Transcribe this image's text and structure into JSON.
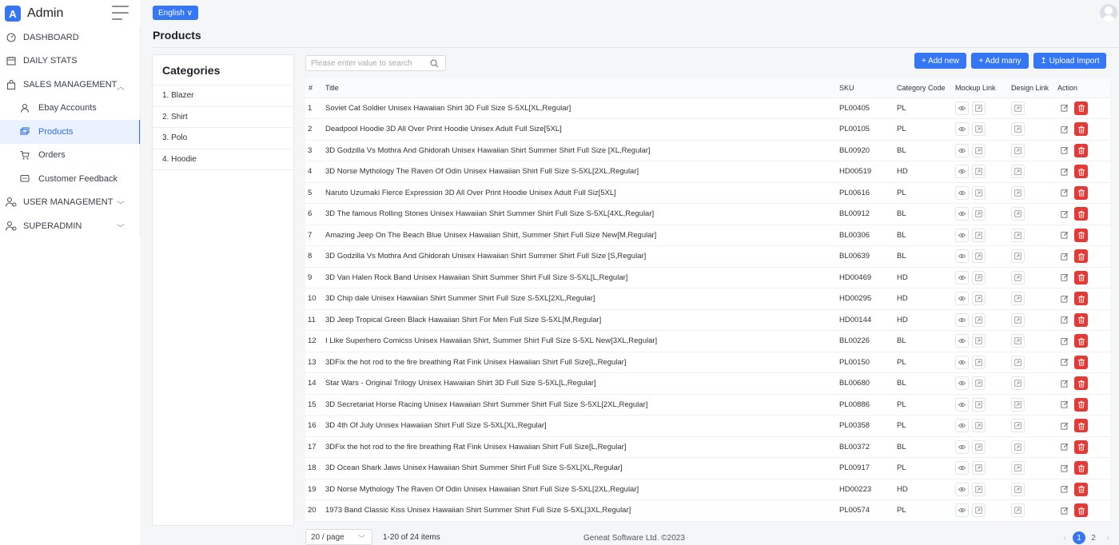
{
  "app": {
    "title": "Admin",
    "logo_letter": "A"
  },
  "language": {
    "label": "English ∨"
  },
  "page": {
    "title": "Products"
  },
  "nav": {
    "dashboard": "DASHBOARD",
    "daily_stats": "DAILY STATS",
    "sales_management": "SALES MANAGEMENT",
    "ebay_accounts": "Ebay Accounts",
    "products": "Products",
    "orders": "Orders",
    "customer_feedback": "Customer Feedback",
    "user_management": "USER MANAGEMENT",
    "superadmin": "SUPERADMIN"
  },
  "categories": {
    "title": "Categories",
    "items": [
      "1. Blazer",
      "2. Shirt",
      "3. Polo",
      "4. Hoodie"
    ]
  },
  "search": {
    "placeholder": "Please enter value to search",
    "value": ""
  },
  "toolbar": {
    "add_new": "+ Add new",
    "add_many": "+ Add many",
    "upload_import": "↥ Upload Import"
  },
  "table": {
    "headers": {
      "num": "#",
      "title": "Title",
      "sku": "SKU",
      "category_code": "Category Code",
      "mockup_link": "Mockup Link",
      "design_link": "Design Link",
      "action": "Action"
    },
    "rows": [
      {
        "n": "1",
        "title": "Soviet Cat Soldier Unisex Hawaiian Shirt 3D Full Size S-5XL[XL,Regular]",
        "sku": "PL00405",
        "cat": "PL"
      },
      {
        "n": "2",
        "title": "Deadpool Hoodie 3D All Over Print Hoodie Unisex Adult Full Size[5XL]",
        "sku": "PL00105",
        "cat": "PL"
      },
      {
        "n": "3",
        "title": "3D Godzilla Vs Mothra And Ghidorah Unisex Hawaiian Shirt Summer Shirt Full Size [XL,Regular]",
        "sku": "BL00920",
        "cat": "BL"
      },
      {
        "n": "4",
        "title": "3D Norse Mythology The Raven Of Odin Unisex Hawaiian Shirt Full Size S-5XL[2XL,Regular]",
        "sku": "HD00519",
        "cat": "HD"
      },
      {
        "n": "5",
        "title": "Naruto Uzumaki Fierce Expression 3D All Over Print Hoodie Unisex Adult Full Siz[5XL]",
        "sku": "PL00616",
        "cat": "PL"
      },
      {
        "n": "6",
        "title": "3D The famous Rolling Stones Unisex Hawaiian Shirt Summer Shirt Full Size S-5XL[4XL,Regular]",
        "sku": "BL00912",
        "cat": "BL"
      },
      {
        "n": "7",
        "title": "Amazing Jeep On The Beach Blue Unisex Hawaiian Shirt, Summer Shirt Full Size New[M,Regular]",
        "sku": "BL00306",
        "cat": "BL"
      },
      {
        "n": "8",
        "title": "3D Godzilla Vs Mothra And Ghidorah Unisex Hawaiian Shirt Summer Shirt Full Size [S,Regular]",
        "sku": "BL00639",
        "cat": "BL"
      },
      {
        "n": "9",
        "title": "3D Van Halen Rock Band Unisex Hawaiian Shirt Summer Shirt Full Size S-5XL[L,Regular]",
        "sku": "HD00469",
        "cat": "HD"
      },
      {
        "n": "10",
        "title": "3D Chip dale Unisex Hawaiian Shirt Summer Shirt Full Size S-5XL[2XL,Regular]",
        "sku": "HD00295",
        "cat": "HD"
      },
      {
        "n": "11",
        "title": "3D Jeep Tropical Green Black Hawaiian Shirt For Men Full Size S-5XL[M,Regular]",
        "sku": "HD00144",
        "cat": "HD"
      },
      {
        "n": "12",
        "title": "I Like Superhero Comicss Unisex Hawaiian Shirt, Summer Shirt Full Size S-5XL New[3XL,Regular]",
        "sku": "BL00226",
        "cat": "BL"
      },
      {
        "n": "13",
        "title": "3DFix the hot rod to the fire breathing Rat Fink Unisex Hawaiian Shirt Full Size[L,Regular]",
        "sku": "PL00150",
        "cat": "PL"
      },
      {
        "n": "14",
        "title": "Star Wars - Original Trilogy Unisex Hawaiian Shirt 3D Full Size S-5XL[L,Regular]",
        "sku": "BL00680",
        "cat": "BL"
      },
      {
        "n": "15",
        "title": "3D Secretariat Horse Racing Unisex Hawaiian Shirt Summer Shirt Full Size S-5XL[2XL,Regular]",
        "sku": "PL00886",
        "cat": "PL"
      },
      {
        "n": "16",
        "title": "3D 4th Of July Unisex Hawaiian Shirt Full Size S-5XL[XL,Regular]",
        "sku": "PL00358",
        "cat": "PL"
      },
      {
        "n": "17",
        "title": "3DFix the hot rod to the fire breathing Rat Fink Unisex Hawaiian Shirt Full Size[L,Regular]",
        "sku": "BL00372",
        "cat": "BL"
      },
      {
        "n": "18",
        "title": "3D Ocean Shark Jaws Unisex Hawaiian Shirt Summer Shirt Full Size S-5XL[XL,Regular]",
        "sku": "PL00917",
        "cat": "PL"
      },
      {
        "n": "19",
        "title": "3D Norse Mythology The Raven Of Odin Unisex Hawaiian Shirt Full Size S-5XL[2XL,Regular]",
        "sku": "HD00223",
        "cat": "HD"
      },
      {
        "n": "20",
        "title": "1973 Band Classic Kiss Unisex Hawaiian Shirt Summer Shirt Full Size S-5XL[3XL,Regular]",
        "sku": "PL00574",
        "cat": "PL"
      }
    ]
  },
  "footer": {
    "page_size": "20 / page",
    "item_count": "1-20 of 24 items",
    "copyright": "Geneat Software Ltd. ©2023",
    "pages": [
      "1",
      "2"
    ],
    "current_page": "1"
  },
  "colors": {
    "primary": "#3576f6",
    "danger": "#e53935",
    "active_bg": "#eaf1ff"
  },
  "icons": [
    "dashboard-icon",
    "calendar-icon",
    "bag-icon",
    "user-icon",
    "products-icon",
    "cart-icon",
    "feedback-icon",
    "users-icon",
    "superadmin-icon",
    "search-icon",
    "eye-icon",
    "open-link-icon",
    "edit-icon",
    "trash-icon",
    "avatar-icon"
  ]
}
